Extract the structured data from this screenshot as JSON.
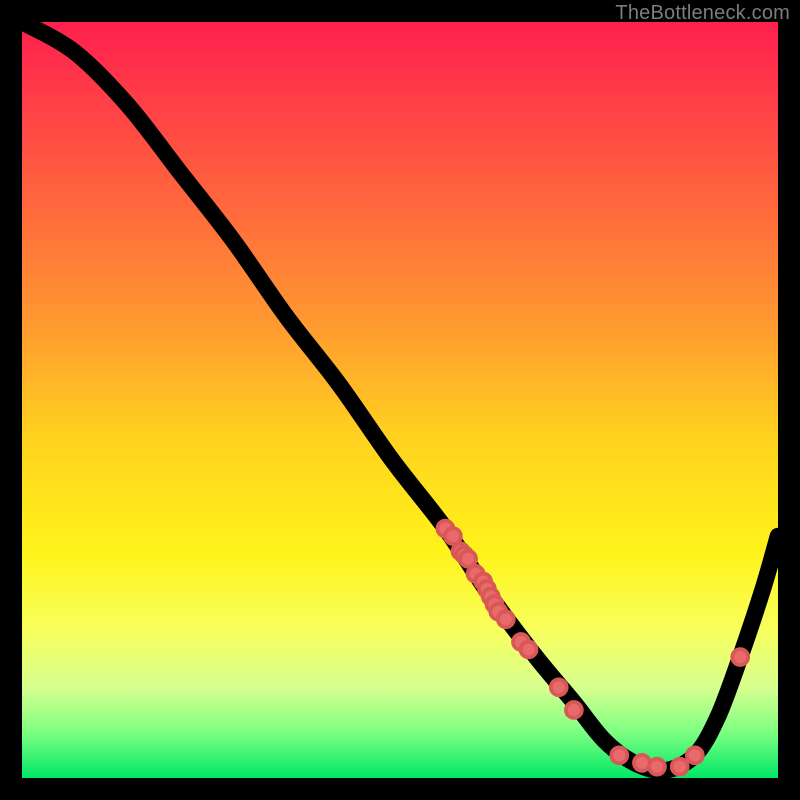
{
  "attribution": "TheBottleneck.com",
  "chart_data": {
    "type": "line",
    "title": "",
    "xlabel": "",
    "ylabel": "",
    "xlim": [
      0,
      100
    ],
    "ylim": [
      0,
      100
    ],
    "grid": false,
    "legend": false,
    "series": [
      {
        "name": "bottleneck-curve",
        "x": [
          0,
          7,
          14,
          21,
          28,
          35,
          42,
          49,
          56,
          62,
          68,
          73,
          77,
          81,
          85,
          89,
          92,
          95,
          98,
          100
        ],
        "y": [
          100,
          96,
          89,
          80,
          71,
          61,
          52,
          42,
          33,
          24,
          16,
          10,
          5,
          2,
          1,
          3,
          8,
          16,
          25,
          32
        ]
      }
    ],
    "markers": {
      "name": "highlighted-points",
      "color": "#e96a6a",
      "x": [
        56,
        57,
        58,
        58.5,
        59,
        60,
        61,
        61.5,
        62,
        62.5,
        63,
        64,
        66,
        67,
        71,
        73,
        79,
        82,
        84,
        87,
        89,
        95
      ],
      "y": [
        33,
        32,
        30,
        29.5,
        29,
        27,
        26,
        25,
        24,
        23,
        22,
        21,
        18,
        17,
        12,
        9,
        3,
        2,
        1.5,
        1.5,
        3,
        16
      ]
    },
    "background_gradient_colors": [
      "#ff1f4d",
      "#ff6a3c",
      "#ffd21f",
      "#fff31a",
      "#7cff82",
      "#00e765"
    ]
  }
}
